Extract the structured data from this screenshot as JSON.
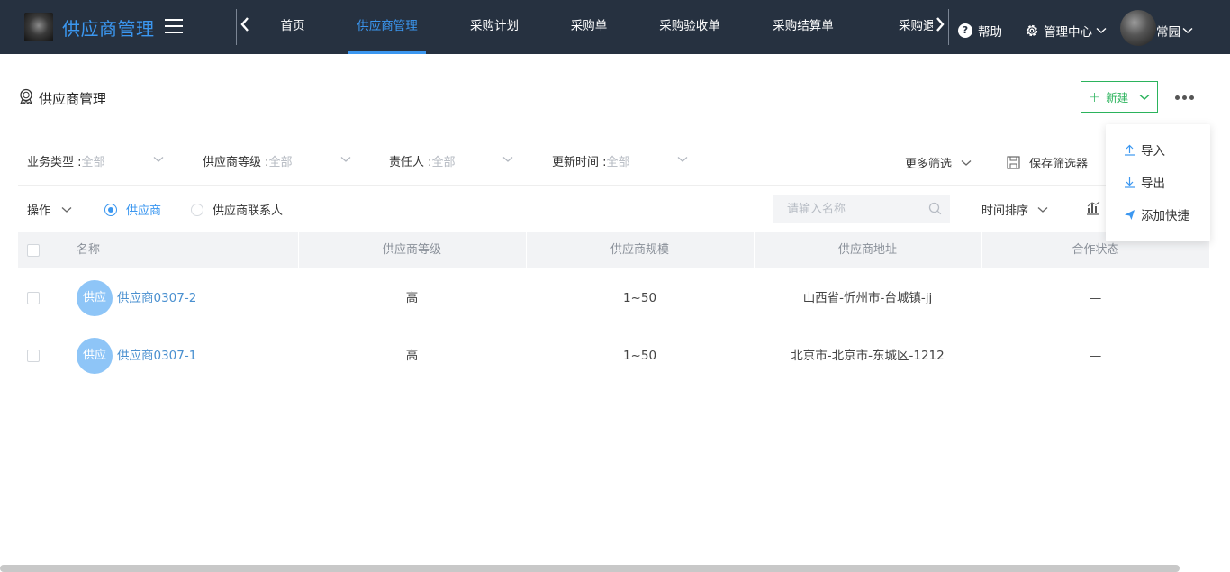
{
  "app": {
    "title": "供应商管理"
  },
  "nav": {
    "tabs": [
      {
        "label": "首页"
      },
      {
        "label": "供应商管理"
      },
      {
        "label": "采购计划"
      },
      {
        "label": "采购单"
      },
      {
        "label": "采购验收单"
      },
      {
        "label": "采购结算单"
      },
      {
        "label": "采购退货"
      }
    ],
    "active_tab": "供应商管理",
    "help_label": "帮助",
    "admin_label": "管理中心",
    "username": "常园"
  },
  "page": {
    "title": "供应商管理",
    "new_button": "新建"
  },
  "filters": {
    "business_type": {
      "label": "业务类型 :",
      "value": "全部"
    },
    "supplier_level": {
      "label": "供应商等级 :",
      "value": "全部"
    },
    "owner": {
      "label": "责任人 :",
      "value": "全部"
    },
    "update_time": {
      "label": "更新时间 :",
      "value": "全部"
    },
    "more_filters": "更多筛选",
    "save_filter": "保存筛选器"
  },
  "toolbar": {
    "operations": "操作",
    "radio_supplier": "供应商",
    "radio_contact": "供应商联系人",
    "selected_radio": "供应商",
    "search_placeholder": "请输入名称",
    "sort_label": "时间排序"
  },
  "table": {
    "headers": [
      "名称",
      "供应商等级",
      "供应商规模",
      "供应商地址",
      "合作状态"
    ],
    "rows": [
      {
        "avatar": "供应",
        "name": "供应商0307-2",
        "level": "高",
        "scale": "1~50",
        "address": "山西省-忻州市-台城镇-jj",
        "status": "—"
      },
      {
        "avatar": "供应",
        "name": "供应商0307-1",
        "level": "高",
        "scale": "1~50",
        "address": "北京市-北京市-东城区-1212",
        "status": "—"
      }
    ]
  },
  "more_menu": {
    "items": [
      {
        "label": "导入",
        "icon": "upload-icon"
      },
      {
        "label": "导出",
        "icon": "download-icon"
      },
      {
        "label": "添加快捷",
        "icon": "send-icon"
      }
    ]
  },
  "colors": {
    "topbar": "#263140",
    "accent": "#3b97f0",
    "new_button": "#2bb35c",
    "avatar_bg": "#8ec5f7"
  }
}
